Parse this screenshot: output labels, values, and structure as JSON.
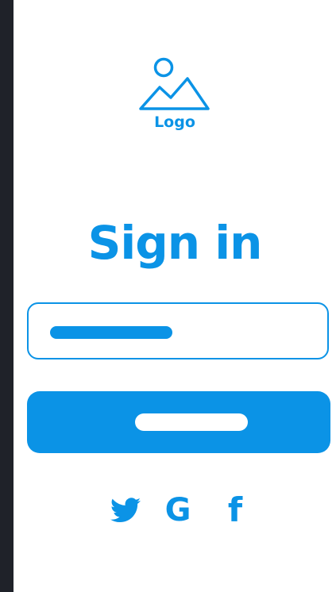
{
  "logo": {
    "icon": "image-placeholder-icon",
    "text": "Logo"
  },
  "title": "Sign in",
  "input": {
    "value_placeholder_shape": "bar"
  },
  "primary_button": {
    "label_placeholder_shape": "bar"
  },
  "social": {
    "icons": [
      "twitter-icon",
      "google-icon",
      "facebook-icon"
    ],
    "google_glyph": "G",
    "facebook_glyph": "f"
  },
  "colors": {
    "accent": "#0b93e6",
    "background": "#ffffff",
    "frame": "#1f2229"
  }
}
